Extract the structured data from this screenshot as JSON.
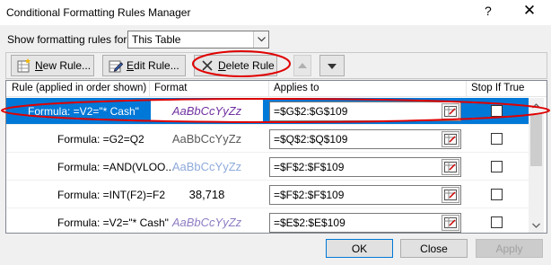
{
  "window": {
    "title": "Conditional Formatting Rules Manager",
    "help_glyph": "?",
    "close_glyph": "✕"
  },
  "filter": {
    "label": "Show formatting rules for:",
    "selected": "This Table"
  },
  "toolbar": {
    "new_rule": "New Rule...",
    "edit_rule": "Edit Rule...",
    "delete_rule": "Delete Rule"
  },
  "columns": {
    "rule": "Rule (applied in order shown)",
    "format": "Format",
    "applies_to": "Applies to",
    "stop_if_true": "Stop If True"
  },
  "rules": [
    {
      "rule": "Formula: =V2=\"* Cash\"",
      "format": "AaBbCcYyZz",
      "applies_to": "=$G$2:$G$109",
      "selected": true
    },
    {
      "rule": "Formula: =G2=Q2",
      "format": "AaBbCcYyZz",
      "applies_to": "=$Q$2:$Q$109"
    },
    {
      "rule": "Formula: =AND(VLOO...",
      "format": "AaBbCcYyZz",
      "applies_to": "=$F$2:$F$109"
    },
    {
      "rule": "Formula: =INT(F2)=F2",
      "format": "38,718",
      "applies_to": "=$F$2:$F$109"
    },
    {
      "rule": "Formula: =V2=\"* Cash\"",
      "format": "AaBbCcYyZz",
      "applies_to": "=$E$2:$E$109"
    }
  ],
  "footer": {
    "ok": "OK",
    "close": "Close",
    "apply": "Apply"
  },
  "colors": {
    "selection": "#0078d7",
    "annotation": "#e00000"
  }
}
